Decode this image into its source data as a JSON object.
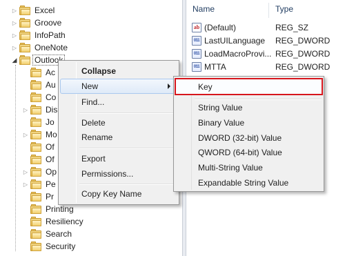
{
  "tree": {
    "items": [
      {
        "label": "Excel",
        "arrow": "▷"
      },
      {
        "label": "Groove",
        "arrow": "▷"
      },
      {
        "label": "InfoPath",
        "arrow": "▷"
      },
      {
        "label": "OneNote",
        "arrow": "▷"
      },
      {
        "label": "Outlook",
        "arrow": "◢"
      },
      {
        "label": "Ac"
      },
      {
        "label": "Au"
      },
      {
        "label": "Co"
      },
      {
        "label": "Dis",
        "arrow": "▷"
      },
      {
        "label": "Jo"
      },
      {
        "label": "Mo",
        "arrow": "▷"
      },
      {
        "label": "Of"
      },
      {
        "label": "Of"
      },
      {
        "label": "Op",
        "arrow": "▷"
      },
      {
        "label": "Pe",
        "arrow": "▷"
      },
      {
        "label": "Pr"
      },
      {
        "label": "Printing"
      },
      {
        "label": "Resiliency"
      },
      {
        "label": "Search"
      },
      {
        "label": "Security"
      }
    ]
  },
  "values_pane": {
    "columns": {
      "name": "Name",
      "type": "Type"
    },
    "rows": [
      {
        "icon": "string-value-icon",
        "icon_text": "ab",
        "name": "(Default)",
        "type": "REG_SZ"
      },
      {
        "icon": "binary-value-icon",
        "icon_text": "011\n110",
        "name": "LastUILanguage",
        "type": "REG_DWORD"
      },
      {
        "icon": "binary-value-icon",
        "icon_text": "011\n110",
        "name": "LoadMacroProvi...",
        "type": "REG_DWORD"
      },
      {
        "icon": "binary-value-icon",
        "icon_text": "011\n110",
        "name": "MTTA",
        "type": "REG_DWORD"
      }
    ]
  },
  "context_menu": {
    "collapse": "Collapse",
    "new": "New",
    "find": "Find...",
    "delete": "Delete",
    "rename": "Rename",
    "export": "Export",
    "permissions": "Permissions...",
    "copy_key_name": "Copy Key Name"
  },
  "new_submenu": {
    "key": "Key",
    "string_value": "String Value",
    "binary_value": "Binary Value",
    "dword_value": "DWORD (32-bit) Value",
    "qword_value": "QWORD (64-bit) Value",
    "multi_string_value": "Multi-String Value",
    "expandable_string_value": "Expandable String Value"
  },
  "colors": {
    "highlight_border": "#d7151c",
    "menu_hover": "#dfeaf8",
    "header_text": "#1e3a5f"
  }
}
